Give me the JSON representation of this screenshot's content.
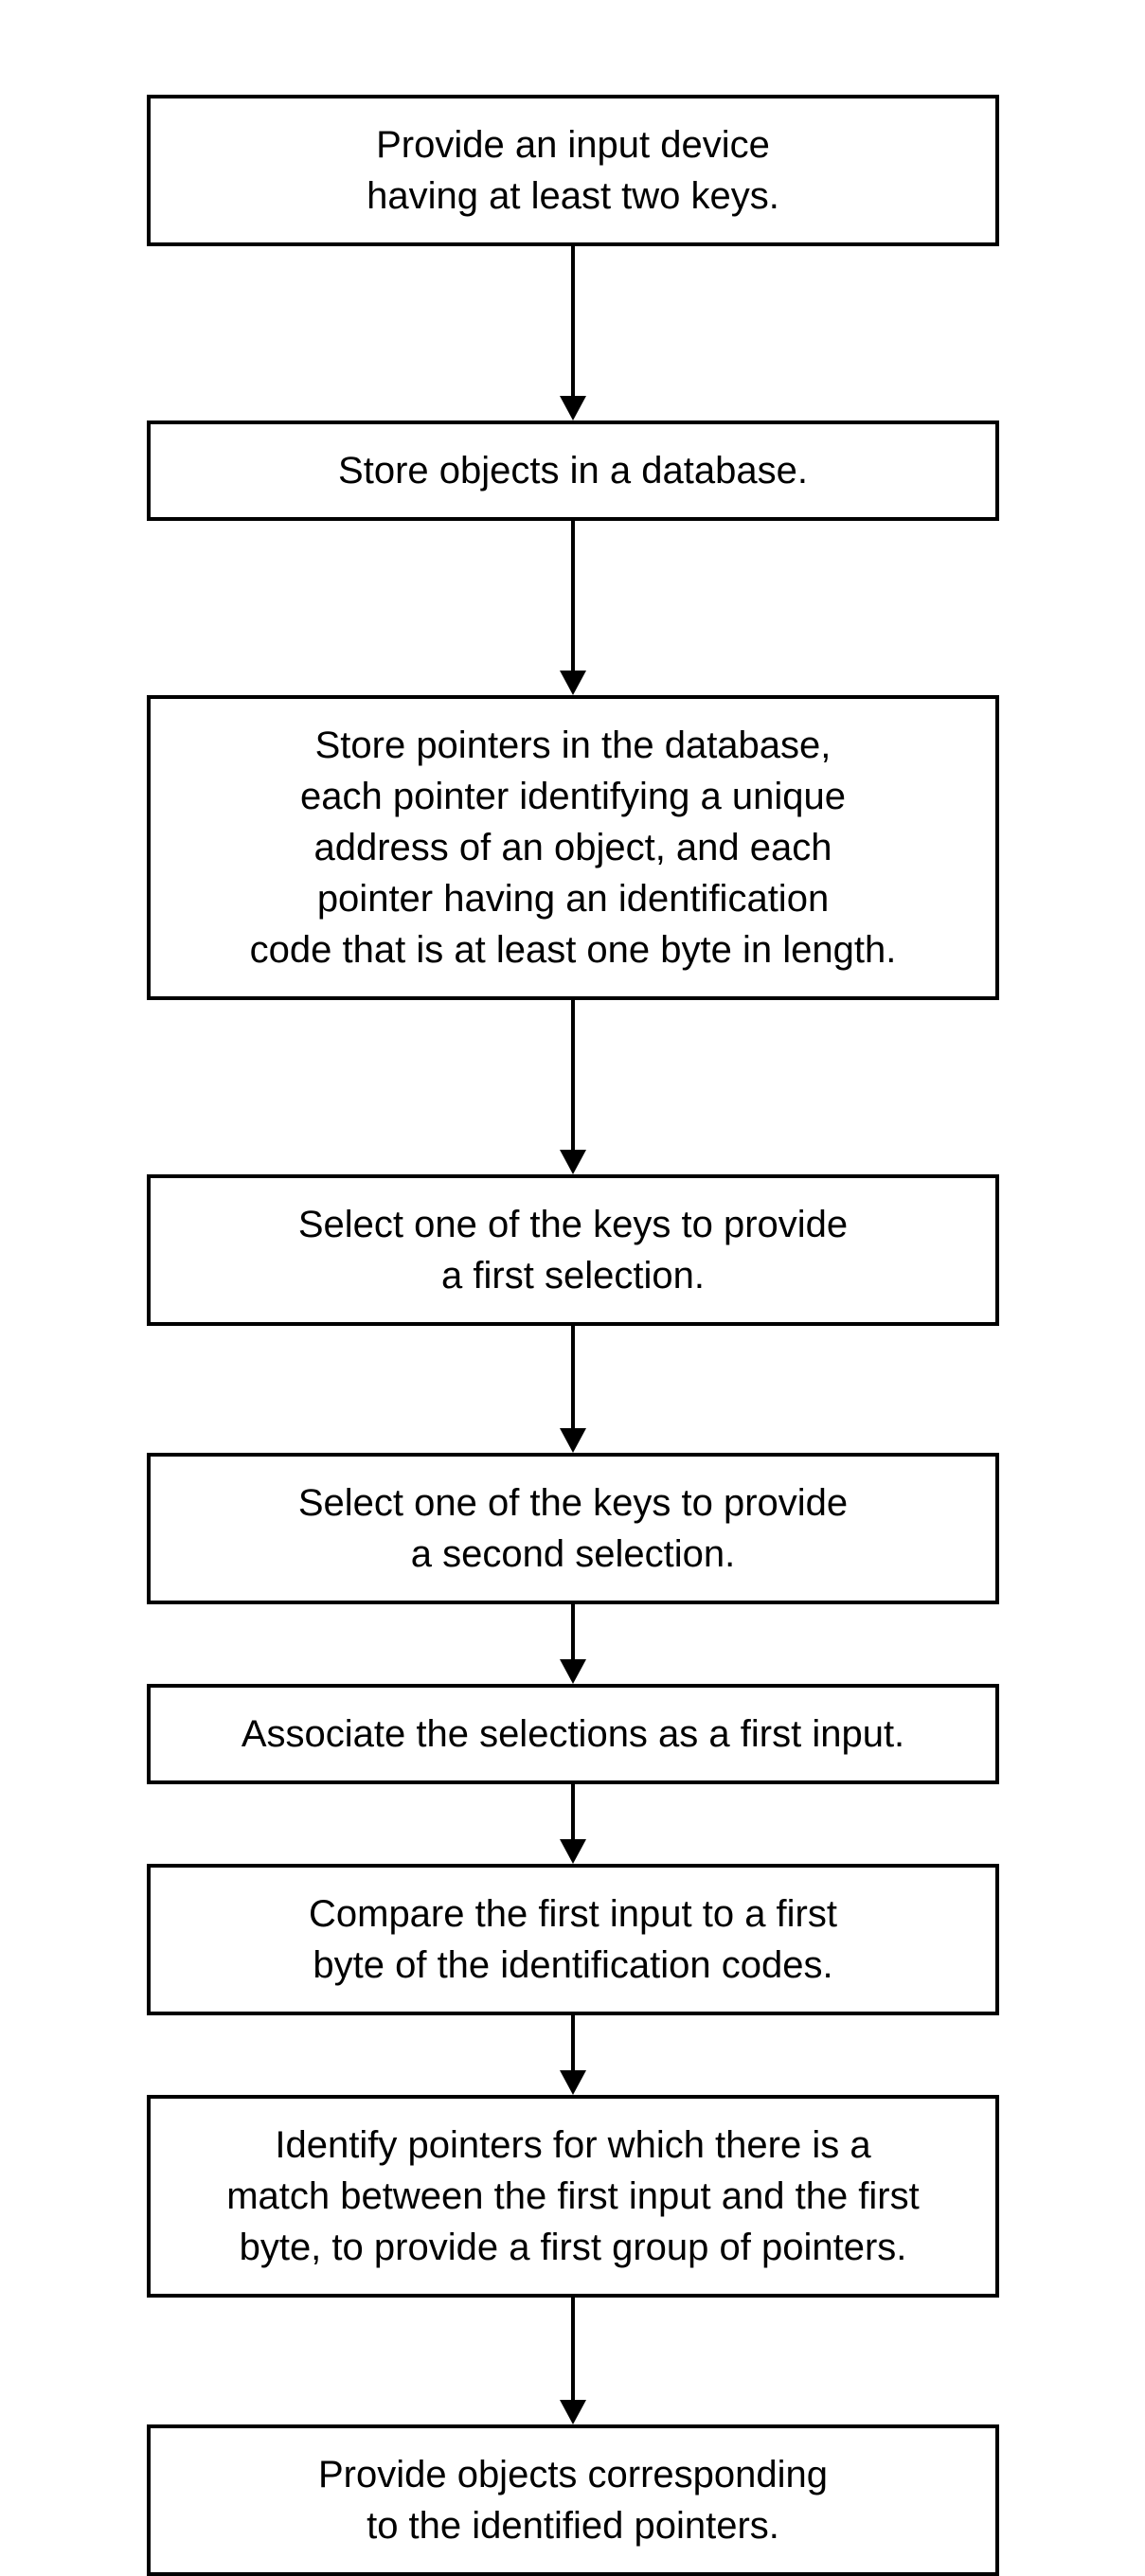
{
  "flowchart": {
    "steps": [
      {
        "text": "Provide an input device\nhaving at least two keys.",
        "arrow": "long"
      },
      {
        "text": "Store objects in a database.",
        "arrow": "long"
      },
      {
        "text": "Store pointers in the database,\neach pointer identifying a unique\naddress of an object, and each\npointer having an identification\ncode that is at least one byte in length.",
        "arrow": "long"
      },
      {
        "text": "Select one of the keys to provide\na first selection.",
        "arrow": "medium"
      },
      {
        "text": "Select one of the keys to provide\na second selection.",
        "arrow": "short"
      },
      {
        "text": "Associate the selections as a first input.",
        "arrow": "short"
      },
      {
        "text": "Compare the first input to a first\nbyte of the identification codes.",
        "arrow": "short"
      },
      {
        "text": "Identify pointers for which there is a\nmatch between the first input and the first\nbyte, to provide a first group of pointers.",
        "arrow": "medium"
      },
      {
        "text": "Provide objects corresponding\nto the identified pointers.",
        "arrow": null
      }
    ]
  }
}
